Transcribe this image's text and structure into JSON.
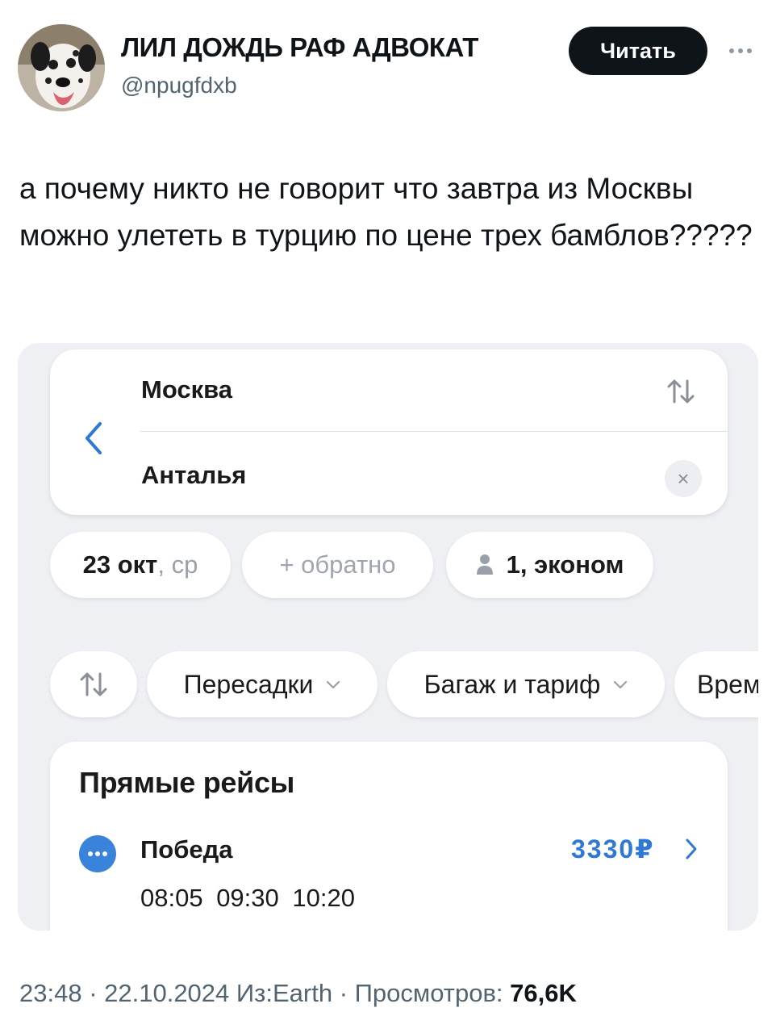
{
  "author": {
    "display_name": "ЛИЛ ДОЖДЬ РАФ АДВОКАТ",
    "handle": "@npugfdxb",
    "follow_label": "Читать"
  },
  "tweet": {
    "text": "а почему никто не говорит что завтра из Москвы можно улететь в турцию по цене трех бамблов?????"
  },
  "embedded_app": {
    "search": {
      "from": "Москва",
      "to": "Анталья",
      "clear_symbol": "×"
    },
    "chips": {
      "date": "23 окт",
      "weekday": ", ср",
      "return": "+ обратно",
      "passengers": "1, эконом"
    },
    "filters": {
      "transfers": "Пересадки",
      "baggage": "Багаж и тариф",
      "time": "Врем"
    },
    "results": {
      "title": "Прямые рейсы",
      "airline": "Победа",
      "price": "3330₽",
      "times": "08:05  09:30  10:20"
    },
    "colors": {
      "accent": "#2f78d4",
      "airline_logo": "#3a83db"
    }
  },
  "footer": {
    "meta": "23:48 · 22.10.2024 Из:Earth · Просмотров: ",
    "views": "76,6K"
  },
  "icons": [
    "dog-avatar",
    "more-icon",
    "back-chevron-icon",
    "swap-icon",
    "clear-icon",
    "person-icon",
    "sort-icon",
    "chevron-down-icon",
    "chevron-right-icon"
  ]
}
